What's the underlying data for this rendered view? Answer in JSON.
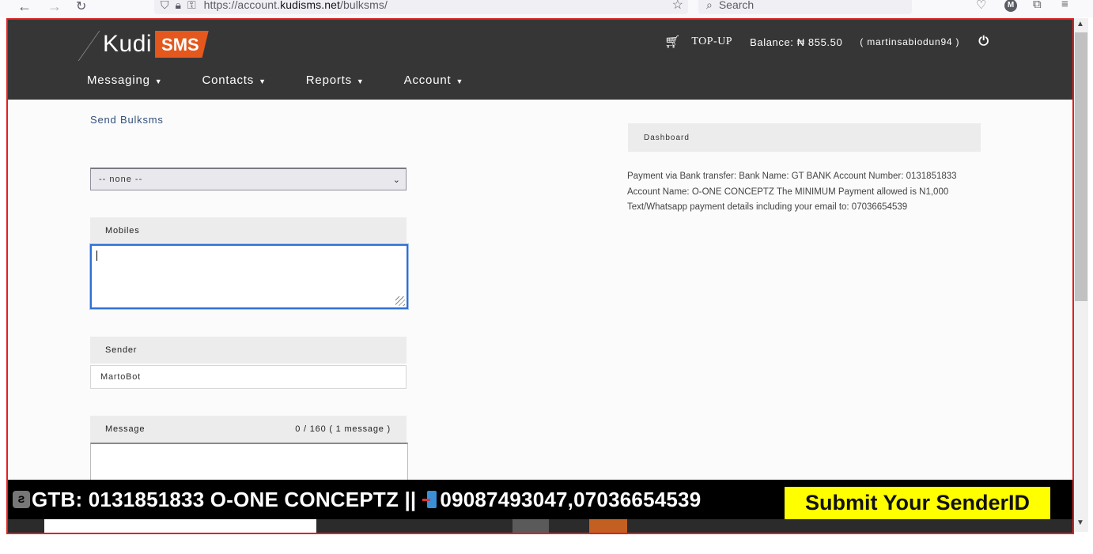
{
  "browser": {
    "url_prefix": "https://account.",
    "url_domain": "kudisms.net",
    "url_path": "/bulksms/",
    "search_placeholder": "Search",
    "profile_initial": "M"
  },
  "header": {
    "logo_kudi": "Kudi",
    "logo_sms": "SMS",
    "topup_label": "TOP-UP",
    "balance": "Balance: ₦ 855.50",
    "username": "( martinsabiodun94 )",
    "nav": [
      "Messaging",
      "Contacts",
      "Reports",
      "Account"
    ]
  },
  "form": {
    "page_link": "Send Bulksms",
    "group_select": "--   none   --",
    "mobiles_label": "Mobiles",
    "mobiles_value": "",
    "sender_label": "Sender",
    "sender_value": "MartoBot",
    "message_label": "Message",
    "message_count": "0 / 160  ( 1 message )"
  },
  "sidebar": {
    "dashboard_label": "Dashboard",
    "payment_text": "Payment via Bank transfer: Bank Name: GT BANK Account Number: 0131851833 Account Name: O-ONE CONCEPTZ The MINIMUM Payment allowed is N1,000 Text/Whatsapp payment details including your email to: 07036654539"
  },
  "ticker": {
    "bank_text": "GTB: 0131851833 O-ONE CONCEPTZ ||",
    "phone_text": "09087493047,07036654539",
    "submit_label": "Submit Your SenderID"
  },
  "colors": {
    "header_bg": "#363636",
    "brand_orange": "#e4581d",
    "frame_border": "#e02020",
    "ticker_button": "#ffff00"
  }
}
